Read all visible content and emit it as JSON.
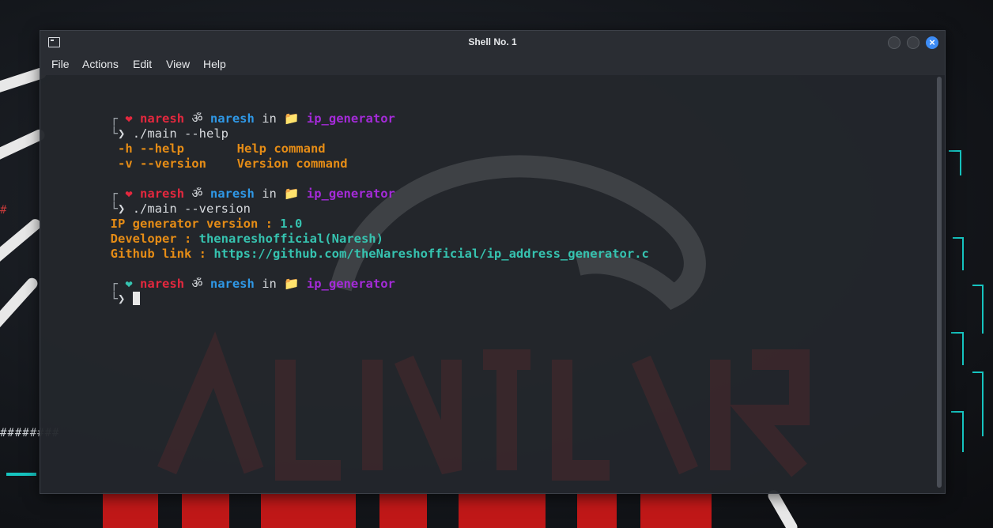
{
  "window": {
    "title": "Shell No. 1"
  },
  "menu": [
    "File",
    "Actions",
    "Edit",
    "View",
    "Help"
  ],
  "prompt": {
    "bracket_top": "┌",
    "bracket_bottom": "└",
    "heart": "❤",
    "user": "naresh",
    "om": "ॐ",
    "host": "naresh",
    "in_word": "in",
    "folder_icon": "📁",
    "dir": "ip_generator",
    "arrow": "❯"
  },
  "session": {
    "cmd1": "./main --help",
    "help_rows": [
      {
        "flag": " -h --help",
        "desc": "Help command"
      },
      {
        "flag": " -v --version",
        "desc": "Version command"
      }
    ],
    "cmd2": "./main --version",
    "version_label": "IP generator version : ",
    "version_value": "1.0",
    "developer_label": "Developer : ",
    "developer_value": "thenareshofficial(Naresh)",
    "github_label": "Github link : ",
    "github_value": "https://github.com/theNareshofficial/ip_address_generator.c"
  },
  "colors": {
    "user": "#e3283e",
    "host": "#2f98e6",
    "dir": "#a42bd8",
    "flag": "#e58c16",
    "value": "#36c3b0",
    "close_button": "#3d8cf5"
  }
}
